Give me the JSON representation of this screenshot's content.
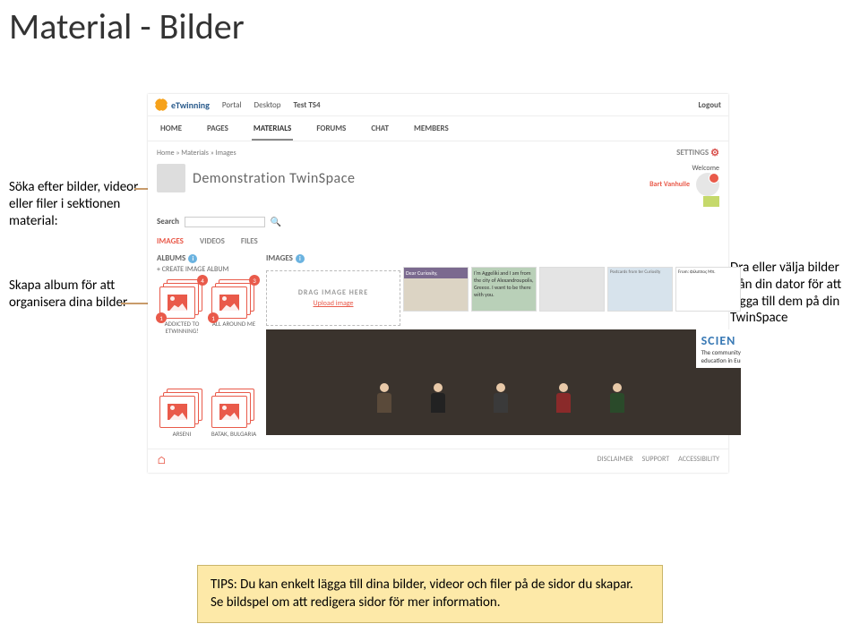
{
  "slide": {
    "title": "Material - Bilder"
  },
  "callouts": {
    "search": "Söka efter bilder, videor eller filer i sektionen material:",
    "albums": "Skapa album för att organisera dina bilder",
    "drop": "Dra eller välja bilder från din dator för att lägga till dem på  din TwinSpace"
  },
  "topbar": {
    "brand": "eTwinning",
    "links": [
      "Portal",
      "Desktop",
      "Test TS4"
    ],
    "logout": "Logout"
  },
  "nav": {
    "items": [
      "HOME",
      "PAGES",
      "MATERIALS",
      "FORUMS",
      "CHAT",
      "MEMBERS"
    ],
    "breadcrumb": "Home  »  Materials  »  Images",
    "settings": "SETTINGS"
  },
  "header": {
    "title": "Demonstration TwinSpace",
    "welcome": "Welcome",
    "user": "Bart Vanhulle"
  },
  "search": {
    "label": "Search",
    "placeholder": ""
  },
  "tabs": {
    "images": "IMAGES",
    "videos": "VIDEOS",
    "files": "FILES"
  },
  "sections": {
    "albums": "ALBUMS",
    "create": "+ CREATE IMAGE ALBUM",
    "images": "IMAGES"
  },
  "albums_row1": [
    {
      "caption": "ADDICTED TO ETWINNING!",
      "top_count": "4",
      "bottom_count": "1"
    },
    {
      "caption": "ALL AROUND ME",
      "top_count": "3",
      "bottom_count": "1"
    }
  ],
  "albums_row2": [
    {
      "caption": "ARSENI"
    },
    {
      "caption": "BATAK, BULGARIA"
    }
  ],
  "dropzone": {
    "label": "DRAG IMAGE HERE",
    "upload": "Upload image"
  },
  "thumbs": [
    {
      "desc": "Dear Curiosity,"
    },
    {
      "desc": "I'm Aggeliki and I am from the city of Alexandroupolis, Greece. I want to be there with you."
    },
    {
      "desc": ""
    },
    {
      "desc": "Postcards from ter Curiosity"
    },
    {
      "desc": "From: Φίλιππος Μπ."
    }
  ],
  "scient": {
    "title": "SCIEN",
    "sub1": "The community for s",
    "sub2": "education in Europe"
  },
  "footer": {
    "links": [
      "DISCLAIMER",
      "SUPPORT",
      "ACCESSIBILITY"
    ]
  },
  "tip": {
    "line1": "TIPS: Du kan enkelt lägga till dina bilder, videor och filer på de sidor du skapar.",
    "line2": "Se bildspel om att redigera sidor för mer information."
  }
}
